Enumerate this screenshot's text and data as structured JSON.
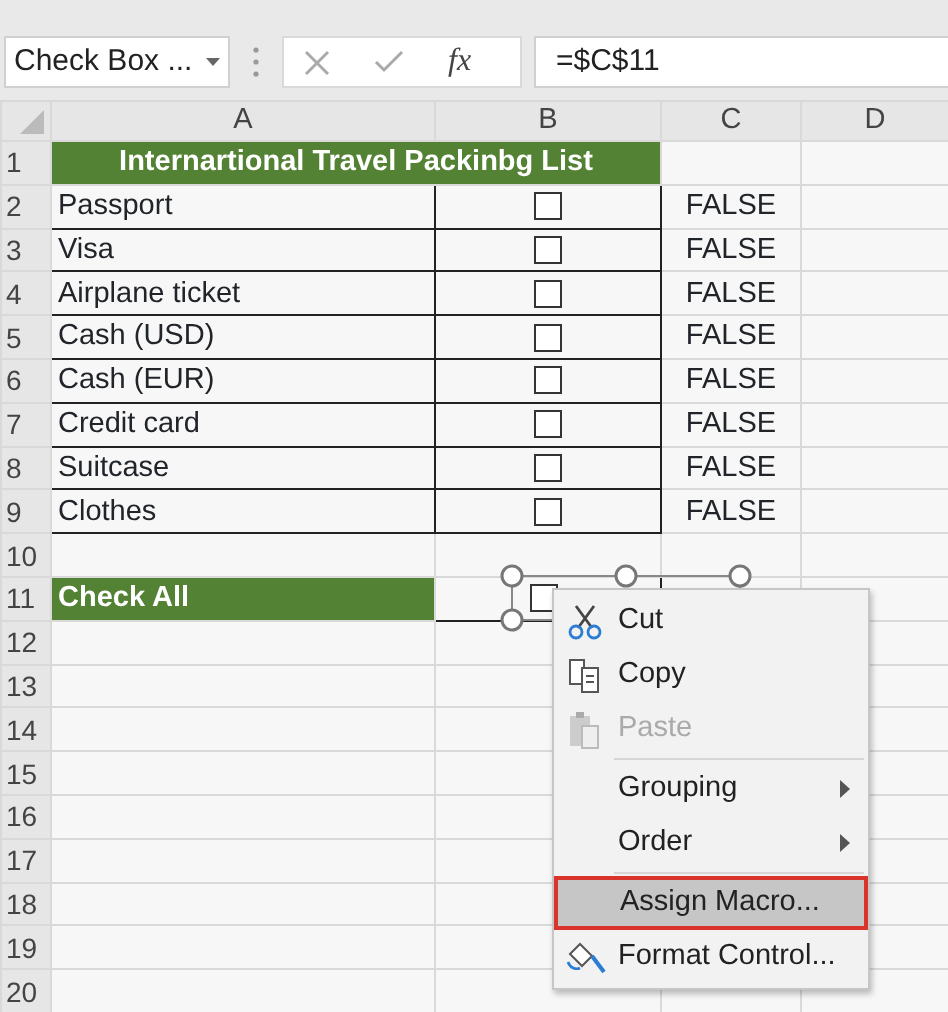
{
  "formula_bar": {
    "name_box": "Check Box ...",
    "function_label": "fx",
    "formula": "=$C$11"
  },
  "sheet": {
    "columns": [
      "A",
      "B",
      "C",
      "D"
    ],
    "rows": [
      {
        "number": "1",
        "kind": "title",
        "text": "Internartional Travel Packinbg List"
      },
      {
        "number": "2",
        "kind": "item",
        "label": "Passport",
        "checked": false,
        "value": "FALSE"
      },
      {
        "number": "3",
        "kind": "item",
        "label": "Visa",
        "checked": false,
        "value": "FALSE"
      },
      {
        "number": "4",
        "kind": "item",
        "label": "Airplane ticket",
        "checked": false,
        "value": "FALSE"
      },
      {
        "number": "5",
        "kind": "item",
        "label": "Cash (USD)",
        "checked": false,
        "value": "FALSE"
      },
      {
        "number": "6",
        "kind": "item",
        "label": "Cash (EUR)",
        "checked": false,
        "value": "FALSE"
      },
      {
        "number": "7",
        "kind": "item",
        "label": "Credit card",
        "checked": false,
        "value": "FALSE"
      },
      {
        "number": "8",
        "kind": "item",
        "label": "Suitcase",
        "checked": false,
        "value": "FALSE"
      },
      {
        "number": "9",
        "kind": "item",
        "label": "Clothes",
        "checked": false,
        "value": "FALSE"
      },
      {
        "number": "10",
        "kind": "empty"
      },
      {
        "number": "11",
        "kind": "control",
        "label": "Check All",
        "checked": false,
        "selected": true
      },
      {
        "number": "12",
        "kind": "empty"
      },
      {
        "number": "13",
        "kind": "empty"
      },
      {
        "number": "14",
        "kind": "empty"
      },
      {
        "number": "15",
        "kind": "empty"
      },
      {
        "number": "16",
        "kind": "empty"
      },
      {
        "number": "17",
        "kind": "empty"
      },
      {
        "number": "18",
        "kind": "empty"
      },
      {
        "number": "19",
        "kind": "empty"
      },
      {
        "number": "20",
        "kind": "empty"
      }
    ]
  },
  "context_menu": [
    {
      "kind": "cut",
      "label": "Cut",
      "disabled": false,
      "submenu": false,
      "highlighted": false
    },
    {
      "kind": "copy",
      "label": "Copy",
      "disabled": false,
      "submenu": false,
      "highlighted": false
    },
    {
      "kind": "paste",
      "label": "Paste",
      "disabled": true,
      "submenu": false,
      "highlighted": false
    },
    {
      "kind": "separator"
    },
    {
      "kind": "plain",
      "label": "Grouping",
      "disabled": false,
      "submenu": true,
      "highlighted": false
    },
    {
      "kind": "plain",
      "label": "Order",
      "disabled": false,
      "submenu": true,
      "highlighted": false
    },
    {
      "kind": "separator"
    },
    {
      "kind": "plain",
      "label": "Assign Macro...",
      "disabled": false,
      "submenu": false,
      "highlighted": true
    },
    {
      "kind": "format",
      "label": "Format Control...",
      "disabled": false,
      "submenu": false,
      "highlighted": false
    }
  ]
}
